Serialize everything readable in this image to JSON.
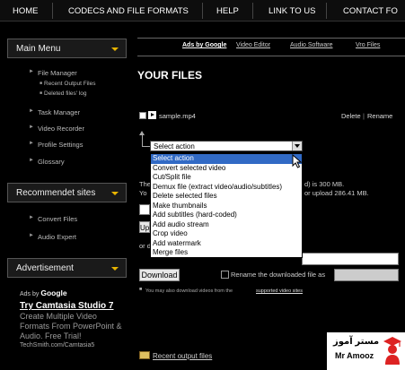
{
  "topnav": {
    "items": [
      "HOME",
      "CODECS AND FILE FORMATS",
      "HELP",
      "LINK TO US",
      "CONTACT FO"
    ]
  },
  "sidebar": {
    "main_menu": {
      "title": "Main Menu",
      "items": [
        {
          "label": "File Manager"
        },
        {
          "label": "Recent Output Files"
        },
        {
          "label": "Deleted files' log"
        },
        {
          "label": "Task Manager"
        },
        {
          "label": "Video Recorder"
        },
        {
          "label": "Profile Settings"
        },
        {
          "label": "Glossary"
        }
      ]
    },
    "recommended": {
      "title": "Recommendet sites",
      "items": [
        {
          "label": "Convert Files"
        },
        {
          "label": "Audio Expert"
        }
      ]
    },
    "advertisement": {
      "title": "Advertisement",
      "ads_by": "Ads by",
      "ads_brand": "Google",
      "ad_title": "Try Camtasia Studio 7",
      "ad_desc": "Create Multiple Video Formats From PowerPoint & Audio. Free Trial!",
      "ad_url": "TechSmith.com/Camtasia5"
    }
  },
  "main": {
    "subnav": {
      "ads_by_google": "Ads by Google",
      "links": [
        "Video Editor",
        "Audio Software",
        "Vro Files"
      ]
    },
    "title": "YOUR FILES",
    "file": {
      "name": "sample.mp4",
      "delete": "Delete",
      "rename": "Rename"
    },
    "select": {
      "value": "Select action",
      "options": [
        "Select action",
        "Convert selected video",
        "Cut/Split file",
        "Demux file (extract video/audio/subtitles)",
        "Delete selected files",
        "Make thumbnails",
        "Add subtitles (hard-coded)",
        "Add audio stream",
        "Crop video",
        "Add watermark",
        "Merge files"
      ]
    },
    "behind": {
      "line1_left": "The",
      "line1_right": "d) is 300 MB.",
      "line2_left": "Yo",
      "line2_right": "or upload 286.41 MB.",
      "upload_btn": "Up",
      "or_d": "or d"
    },
    "download_btn": "Download",
    "rename_label": "Rename the downloaded file as",
    "note_prefix": "You may also download videos from the",
    "note_link": "supported video sites",
    "recent_output": "Recent output files"
  },
  "watermark": {
    "persian": "مستر آموز",
    "latin": "Mr Amooz"
  },
  "colors": {
    "accent_caret": "#e8b400",
    "selection": "#316ac5",
    "background": "#000000"
  }
}
